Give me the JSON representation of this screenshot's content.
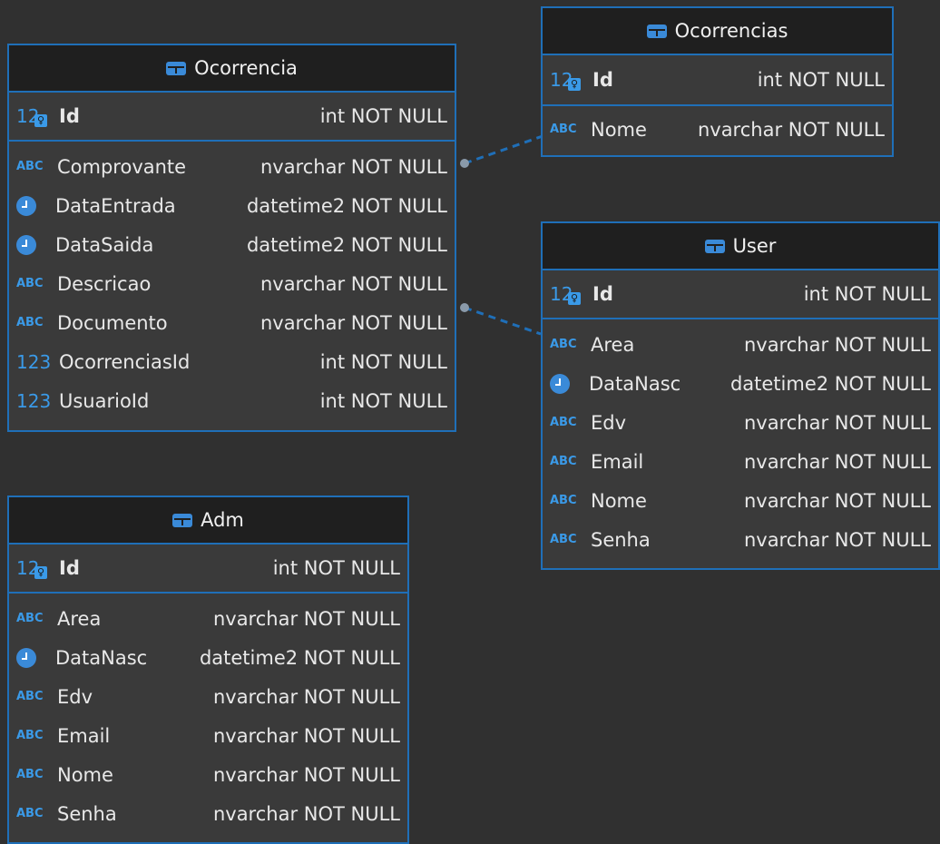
{
  "entities": {
    "ocorrencia": {
      "title": "Ocorrencia",
      "pk": {
        "name": "Id",
        "type": "int NOT NULL",
        "icon": "key-icon"
      },
      "attributes": [
        {
          "name": "Comprovante",
          "type": "nvarchar NOT NULL",
          "icon": "abc-icon"
        },
        {
          "name": "DataEntrada",
          "type": "datetime2 NOT NULL",
          "icon": "clock-icon"
        },
        {
          "name": "DataSaida",
          "type": "datetime2 NOT NULL",
          "icon": "clock-icon"
        },
        {
          "name": "Descricao",
          "type": "nvarchar NOT NULL",
          "icon": "abc-icon"
        },
        {
          "name": "Documento",
          "type": "nvarchar NOT NULL",
          "icon": "abc-icon"
        },
        {
          "name": "OcorrenciasId",
          "type": "int NOT NULL",
          "icon": "number-icon"
        },
        {
          "name": "UsuarioId",
          "type": "int NOT NULL",
          "icon": "number-icon"
        }
      ]
    },
    "ocorrencias": {
      "title": "Ocorrencias",
      "pk": {
        "name": "Id",
        "type": "int NOT NULL",
        "icon": "key-icon"
      },
      "attributes": [
        {
          "name": "Nome",
          "type": "nvarchar NOT NULL",
          "icon": "abc-icon"
        }
      ]
    },
    "user": {
      "title": "User",
      "pk": {
        "name": "Id",
        "type": "int NOT NULL",
        "icon": "key-icon"
      },
      "attributes": [
        {
          "name": "Area",
          "type": "nvarchar NOT NULL",
          "icon": "abc-icon"
        },
        {
          "name": "DataNasc",
          "type": "datetime2 NOT NULL",
          "icon": "clock-icon"
        },
        {
          "name": "Edv",
          "type": "nvarchar NOT NULL",
          "icon": "abc-icon"
        },
        {
          "name": "Email",
          "type": "nvarchar NOT NULL",
          "icon": "abc-icon"
        },
        {
          "name": "Nome",
          "type": "nvarchar NOT NULL",
          "icon": "abc-icon"
        },
        {
          "name": "Senha",
          "type": "nvarchar NOT NULL",
          "icon": "abc-icon"
        }
      ]
    },
    "adm": {
      "title": "Adm",
      "pk": {
        "name": "Id",
        "type": "int NOT NULL",
        "icon": "key-icon"
      },
      "attributes": [
        {
          "name": "Area",
          "type": "nvarchar NOT NULL",
          "icon": "abc-icon"
        },
        {
          "name": "DataNasc",
          "type": "datetime2 NOT NULL",
          "icon": "clock-icon"
        },
        {
          "name": "Edv",
          "type": "nvarchar NOT NULL",
          "icon": "abc-icon"
        },
        {
          "name": "Email",
          "type": "nvarchar NOT NULL",
          "icon": "abc-icon"
        },
        {
          "name": "Nome",
          "type": "nvarchar NOT NULL",
          "icon": "abc-icon"
        },
        {
          "name": "Senha",
          "type": "nvarchar NOT NULL",
          "icon": "abc-icon"
        }
      ]
    }
  },
  "relationships": [
    {
      "from": "ocorrencia",
      "to": "ocorrencias",
      "style": "dashed"
    },
    {
      "from": "ocorrencia",
      "to": "user",
      "style": "dashed"
    }
  ],
  "colors": {
    "background": "#303030",
    "border": "#1f6fb8",
    "header": "#1f1f1f",
    "body": "#3a3a3a",
    "icon": "#3a9ae8"
  }
}
